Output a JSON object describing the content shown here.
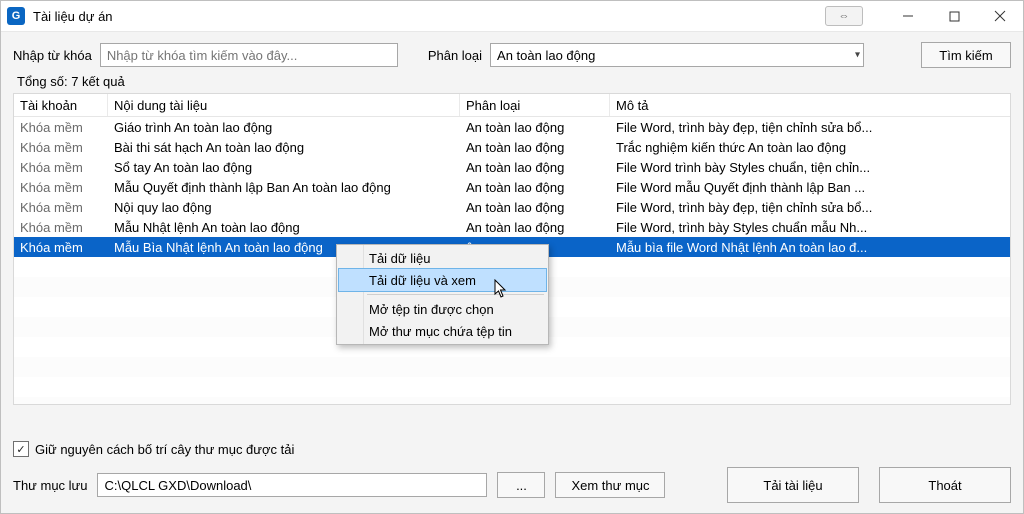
{
  "window": {
    "title": "Tài liệu dự án",
    "app_icon_letter": "G",
    "swap_glyph": "⇔"
  },
  "search": {
    "keyword_label": "Nhập từ khóa",
    "keyword_placeholder": "Nhập từ khóa tìm kiếm vào đây...",
    "category_label": "Phân loại",
    "category_value": "An toàn lao động",
    "search_btn": "Tìm kiếm"
  },
  "total_label": "Tổng số: 7 kết quả",
  "columns": {
    "account": "Tài khoản",
    "content": "Nội dung tài liệu",
    "category": "Phân loại",
    "desc": "Mô tả"
  },
  "rows": [
    {
      "account": "Khóa mềm",
      "content": "Giáo trình An toàn lao động",
      "category": "An toàn lao động",
      "desc": "File Word, trình bày đẹp, tiện chỉnh sửa bổ..."
    },
    {
      "account": "Khóa mềm",
      "content": "Bài thi sát hạch An toàn lao động",
      "category": "An toàn lao động",
      "desc": "Trắc nghiệm kiến thức An toàn lao động"
    },
    {
      "account": "Khóa mềm",
      "content": "Sổ tay An toàn lao động",
      "category": "An toàn lao động",
      "desc": "File Word trình bày Styles chuẩn, tiện chỉn..."
    },
    {
      "account": "Khóa mềm",
      "content": "Mẫu Quyết định thành lập Ban An toàn lao động",
      "category": "An toàn lao động",
      "desc": "File Word mẫu Quyết định thành lập Ban ..."
    },
    {
      "account": "Khóa mềm",
      "content": "Nội quy lao động",
      "category": "An toàn lao động",
      "desc": "File Word, trình bày đẹp, tiện chỉnh sửa bổ..."
    },
    {
      "account": "Khóa mềm",
      "content": "Mẫu Nhật lệnh An toàn lao động",
      "category": "An toàn lao động",
      "desc": "File Word, trình bày Styles chuẩn mẫu Nh..."
    },
    {
      "account": "Khóa mềm",
      "content": "Mẫu Bìa Nhật lệnh An toàn lao động",
      "category": "ộng",
      "desc": "Mẫu bìa file Word Nhật lệnh An toàn lao đ..."
    }
  ],
  "selected_index": 6,
  "context_menu": {
    "items": [
      "Tải dữ liệu",
      "Tải dữ liệu và xem",
      "Mở tệp tin được chọn",
      "Mở thư mục chứa tệp tin"
    ],
    "highlight_index": 1
  },
  "bottom": {
    "keep_tree_label": "Giữ nguyên cách bố trí cây thư mục được tải",
    "keep_tree_checked": true,
    "save_dir_label": "Thư mục lưu",
    "save_dir_value": "C:\\QLCL GXD\\Download\\",
    "browse_btn": "...",
    "view_folder_btn": "Xem thư mục",
    "download_btn": "Tải tài liệu",
    "close_btn": "Thoát"
  }
}
